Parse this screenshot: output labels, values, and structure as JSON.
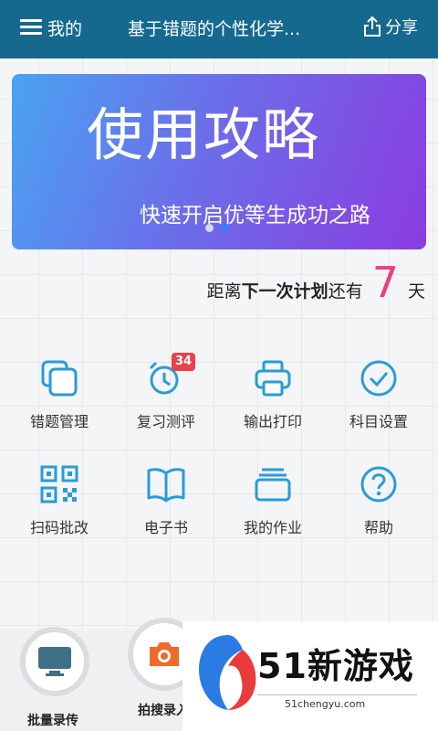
{
  "header": {
    "menu_label": "我的",
    "title": "基于错题的个性化学...",
    "share_label": "分享"
  },
  "banner": {
    "title": "使用攻略",
    "subtitle": "快速开启优等生成功之路",
    "pages": 2,
    "active_page": 1
  },
  "countdown": {
    "prefix": "距离",
    "highlight": "下一次计划",
    "middle": "还有",
    "days": "7",
    "suffix": "天"
  },
  "features": [
    {
      "label": "错题管理",
      "icon": "copy-icon"
    },
    {
      "label": "复习测评",
      "icon": "alarm-clock-icon",
      "badge": "34"
    },
    {
      "label": "输出打印",
      "icon": "printer-icon"
    },
    {
      "label": "科目设置",
      "icon": "check-circle-icon"
    },
    {
      "label": "扫码批改",
      "icon": "qr-code-icon"
    },
    {
      "label": "电子书",
      "icon": "book-icon"
    },
    {
      "label": "我的作业",
      "icon": "stack-icon"
    },
    {
      "label": "帮助",
      "icon": "help-icon"
    }
  ],
  "bottom": {
    "batch_label": "批量录传",
    "photo_label": "拍搜录入"
  },
  "watermark": {
    "text": "51新游戏",
    "domain": "51chengyu.com"
  },
  "colors": {
    "header": "#15698f",
    "accent": "#2a9bd8",
    "badge": "#e9424a",
    "days": "#e9407b"
  }
}
